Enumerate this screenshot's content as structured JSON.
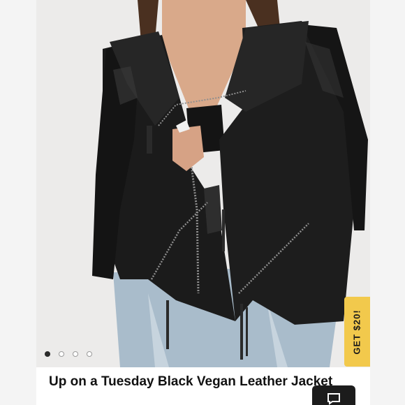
{
  "product": {
    "title": "Up on a Tuesday Black Vegan Leather Jacket"
  },
  "carousel": {
    "slide_count": 4,
    "active_index": 0
  },
  "promo": {
    "label": "GET $20!",
    "color": "#f2c94c"
  },
  "chat": {
    "icon": "chat-bubble-icon"
  }
}
